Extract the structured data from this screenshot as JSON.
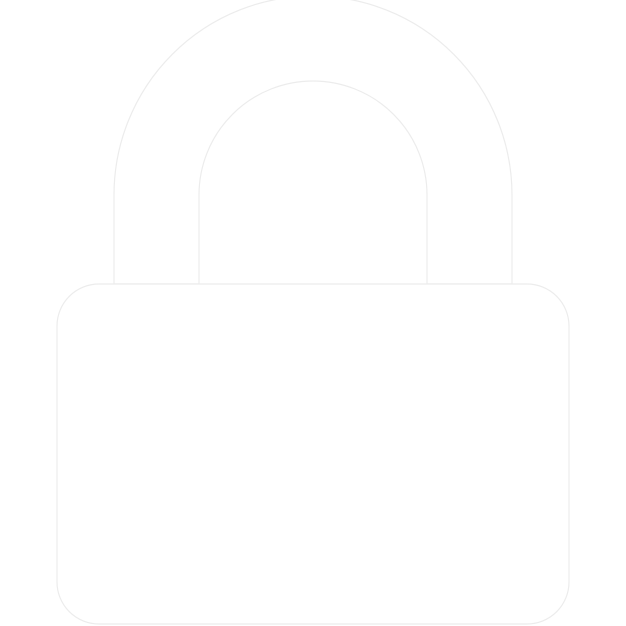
{
  "icon": {
    "name": "lock-icon",
    "fill_color": "#ffffff",
    "edge_color": "#ececec",
    "background_color": "#ffffff"
  }
}
